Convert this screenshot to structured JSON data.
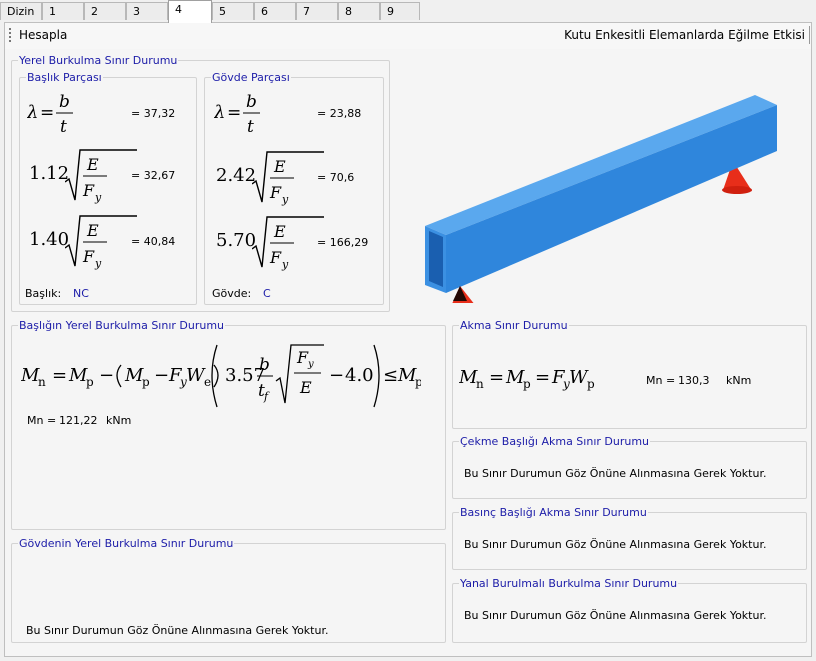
{
  "tabs": [
    "Dizin",
    "1",
    "2",
    "3",
    "4",
    "5",
    "6",
    "7",
    "8",
    "9"
  ],
  "active_tab": "4",
  "toolbar": {
    "hesapla_label": "Hesapla",
    "title": "Kutu Enkesitli Elemanlarda Eğilme Etkisi"
  },
  "yerel": {
    "title": "Yerel Burkulma Sınır Durumu",
    "baslik": {
      "title": "Başlık Parçası",
      "lambda_value": "37,32",
      "c1": "1.12",
      "c1_value": "32,67",
      "c2": "1.40",
      "c2_value": "40,84",
      "class_label": "Başlık:",
      "class_value": "NC"
    },
    "govde": {
      "title": "Gövde Parçası",
      "lambda_value": "23,88",
      "c1": "2.42",
      "c1_value": "70,6",
      "c2": "5.70",
      "c2_value": "166,29",
      "class_label": "Gövde:",
      "class_value": "C"
    }
  },
  "basligin": {
    "title": "Başlığın Yerel Burkulma Sınır Durumu",
    "c1": "3.57",
    "c2": "4.0",
    "mn_label": "Mn =",
    "mn_value": "121,22",
    "unit": "kNm"
  },
  "akma": {
    "title": "Akma Sınır Durumu",
    "mn_label": "Mn =",
    "mn_value": "130,3",
    "unit": "kNm"
  },
  "cekme": {
    "title": "Çekme Başlığı Akma Sınır Durumu",
    "text": "Bu Sınır Durumun Göz Önüne Alınmasına Gerek Yoktur."
  },
  "basinc": {
    "title": "Basınç Başlığı Akma Sınır Durumu",
    "text": "Bu Sınır Durumun Göz Önüne Alınmasına Gerek Yoktur."
  },
  "yanal": {
    "title": "Yanal Burulmalı Burkulma Sınır Durumu",
    "text": "Bu Sınır Durumun Göz Önüne Alınmasına Gerek Yoktur."
  },
  "govdenin": {
    "title": "Gövdenin Yerel Burkulma Sınır Durumu",
    "text": "Bu Sınır Durumun Göz Önüne Alınmasına Gerek Yoktur."
  },
  "colors": {
    "beam_top": "#5aa8ee",
    "beam_front": "#2f86dc",
    "support": "#e82e1a",
    "label_blue": "#1c1ca8"
  }
}
